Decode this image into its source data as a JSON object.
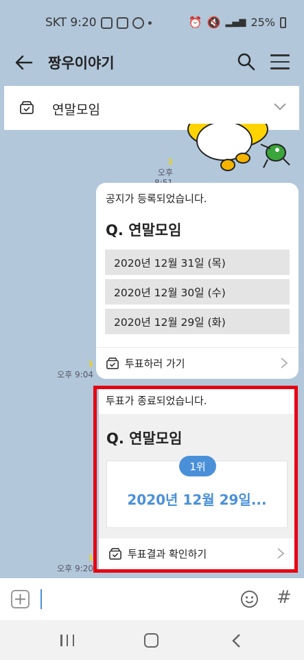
{
  "status_bar": {
    "carrier_time": "SKT 9:20",
    "battery": "25%"
  },
  "header": {
    "title": "짱우이야기"
  },
  "notice": {
    "text": "연말모임"
  },
  "meta": {
    "m1_unread": "1",
    "m1_time": "오후 8:51",
    "m2_unread": "1",
    "m2_time": "오후 9:04",
    "m3_unread": "1",
    "m3_time": "오후 9:20"
  },
  "poll_card": {
    "header": "공지가 등록되었습니다.",
    "question": "Q. 연말모임",
    "options": [
      "2020년 12월 31일 (목)",
      "2020년 12월 30일 (수)",
      "2020년 12월 29일 (화)"
    ],
    "footer": "투표하러 가기"
  },
  "result_card": {
    "header": "투표가 종료되었습니다.",
    "question": "Q. 연말모임",
    "rank": "1위",
    "winner": "2020년 12월 29일...",
    "footer": "투표결과 확인하기"
  },
  "input": {
    "hash": "#"
  },
  "colors": {
    "chat_bg": "#b2c7da",
    "accent": "#4a90d9",
    "highlight": "#e60012",
    "unread": "#f5d400"
  }
}
